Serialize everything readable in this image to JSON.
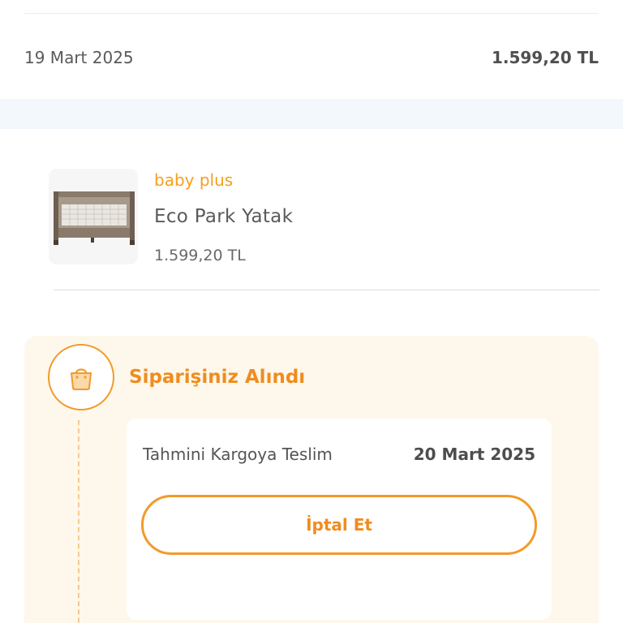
{
  "order": {
    "date": "19 Mart 2025",
    "total": "1.599,20 TL"
  },
  "product": {
    "brand": "baby plus",
    "name": "Eco Park Yatak",
    "price": "1.599,20 TL",
    "thumbnail_icon": "playpen-product-image"
  },
  "status": {
    "title": "Siparişiniz Alındı",
    "icon": "shopping-bag-icon",
    "eta_label": "Tahmini Kargoya Teslim",
    "eta_date": "20 Mart 2025",
    "cancel_label": "İptal Et"
  },
  "colors": {
    "accent": "#f39a2a",
    "brand": "#f5a020",
    "card_bg": "#fef8ec",
    "band_bg": "#f3f8fd"
  }
}
